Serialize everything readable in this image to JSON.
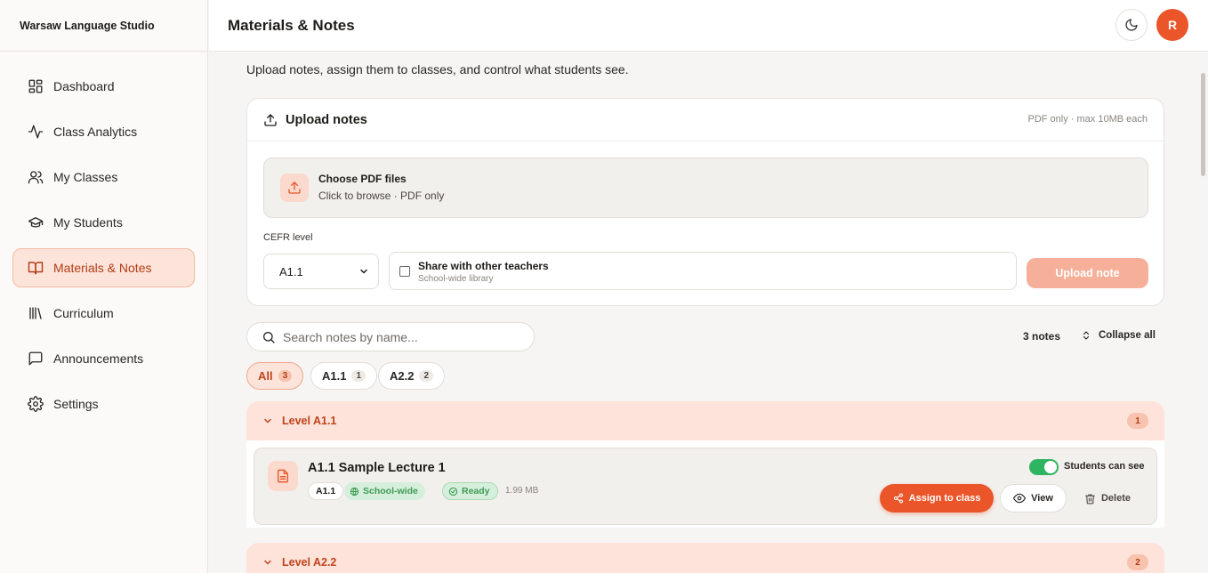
{
  "brand": "Warsaw Language Studio",
  "sidebar": {
    "items": [
      {
        "label": "Dashboard",
        "icon": "dashboard-icon"
      },
      {
        "label": "Class Analytics",
        "icon": "activity-icon"
      },
      {
        "label": "My Classes",
        "icon": "users-icon"
      },
      {
        "label": "My Students",
        "icon": "graduation-cap-icon"
      },
      {
        "label": "Materials & Notes",
        "icon": "book-open-icon",
        "active": true
      },
      {
        "label": "Curriculum",
        "icon": "library-icon"
      },
      {
        "label": "Announcements",
        "icon": "message-square-icon"
      },
      {
        "label": "Settings",
        "icon": "gear-icon"
      }
    ]
  },
  "header": {
    "title": "Materials & Notes",
    "avatar_initial": "R"
  },
  "main": {
    "subtitle": "Upload notes, assign them to classes, and control what students see."
  },
  "upload": {
    "title": "Upload notes",
    "hint": "PDF only · max 10MB each",
    "dropzone_title": "Choose PDF files",
    "dropzone_sub": "Click to browse · PDF only",
    "cefr_label": "CEFR level",
    "cefr_value": "A1.1",
    "share_title": "Share with other teachers",
    "share_sub": "School-wide library",
    "button": "Upload note"
  },
  "search": {
    "placeholder": "Search notes by name..."
  },
  "toolbar": {
    "count": "3 notes",
    "collapse": "Collapse all"
  },
  "filters": [
    {
      "label": "All",
      "count": "3",
      "active": true
    },
    {
      "label": "A1.1",
      "count": "1"
    },
    {
      "label": "A2.2",
      "count": "2"
    }
  ],
  "groups": [
    {
      "label": "Level A1.1",
      "count": "1",
      "notes": [
        {
          "title": "A1.1 Sample Lecture 1",
          "level": "A1.1",
          "scope": "School-wide",
          "status": "Ready",
          "size": "1.99 MB",
          "visibility_label": "Students can see",
          "assign": "Assign to class",
          "view": "View",
          "delete": "Delete"
        }
      ]
    },
    {
      "label": "Level A2.2",
      "count": "2"
    }
  ],
  "colors": {
    "accent": "#ea5529",
    "accent_soft": "#fde4da",
    "success": "#2fb562"
  }
}
